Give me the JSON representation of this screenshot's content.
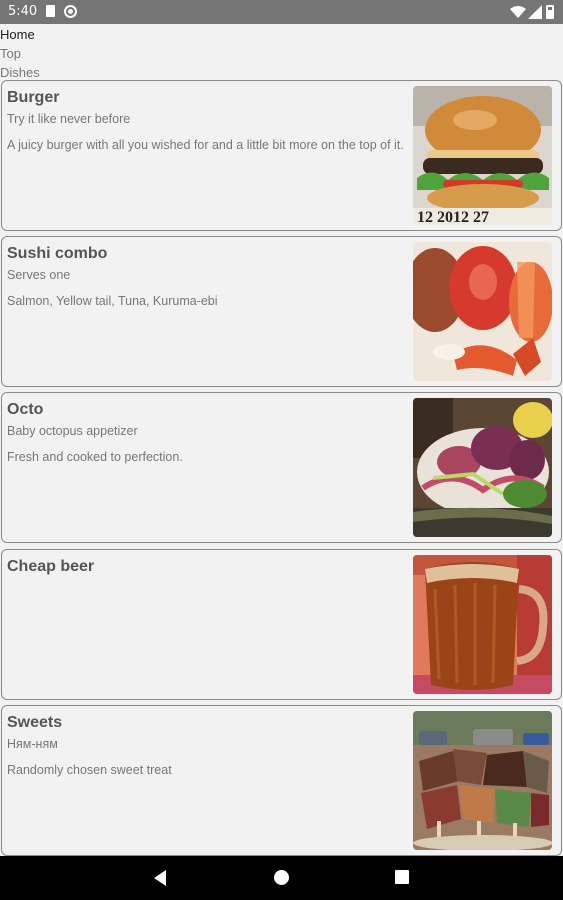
{
  "status_bar": {
    "time": "5:40",
    "icons": [
      "sim-card-icon",
      "data-saver-icon",
      "wifi-icon",
      "signal-icon",
      "battery-icon"
    ]
  },
  "nav": {
    "items": [
      {
        "label": "Home",
        "active": true
      },
      {
        "label": "Top",
        "active": false
      },
      {
        "label": "Dishes",
        "active": false
      }
    ]
  },
  "dishes": [
    {
      "title": "Burger",
      "subtitle": "Try it like never before",
      "description": "A juicy burger with all you wished for and a little bit more on the top of it.",
      "image": "burger-photo",
      "image_text": "12 2012 27"
    },
    {
      "title": "Sushi combo",
      "subtitle": "Serves one",
      "description": "Salmon, Yellow tail, Tuna, Kuruma-ebi",
      "image": "sushi-photo"
    },
    {
      "title": "Octo",
      "subtitle": "Baby octopus appetizer",
      "description": "Fresh and cooked to perfection.",
      "image": "octopus-photo"
    },
    {
      "title": "Cheap beer",
      "subtitle": "",
      "description": "",
      "image": "beer-photo"
    },
    {
      "title": "Sweets",
      "subtitle": "Ням-ням",
      "description": "Randomly chosen sweet treat",
      "image": "sweets-photo"
    }
  ],
  "system_nav": {
    "icons": [
      "back-icon",
      "home-icon",
      "recents-icon"
    ]
  },
  "colors": {
    "status_bar": "#757575",
    "background": "#f2f2f2",
    "card_border": "#8a8a8a",
    "title_text": "#555555",
    "body_text": "#777777",
    "nav_bar": "#000000"
  }
}
